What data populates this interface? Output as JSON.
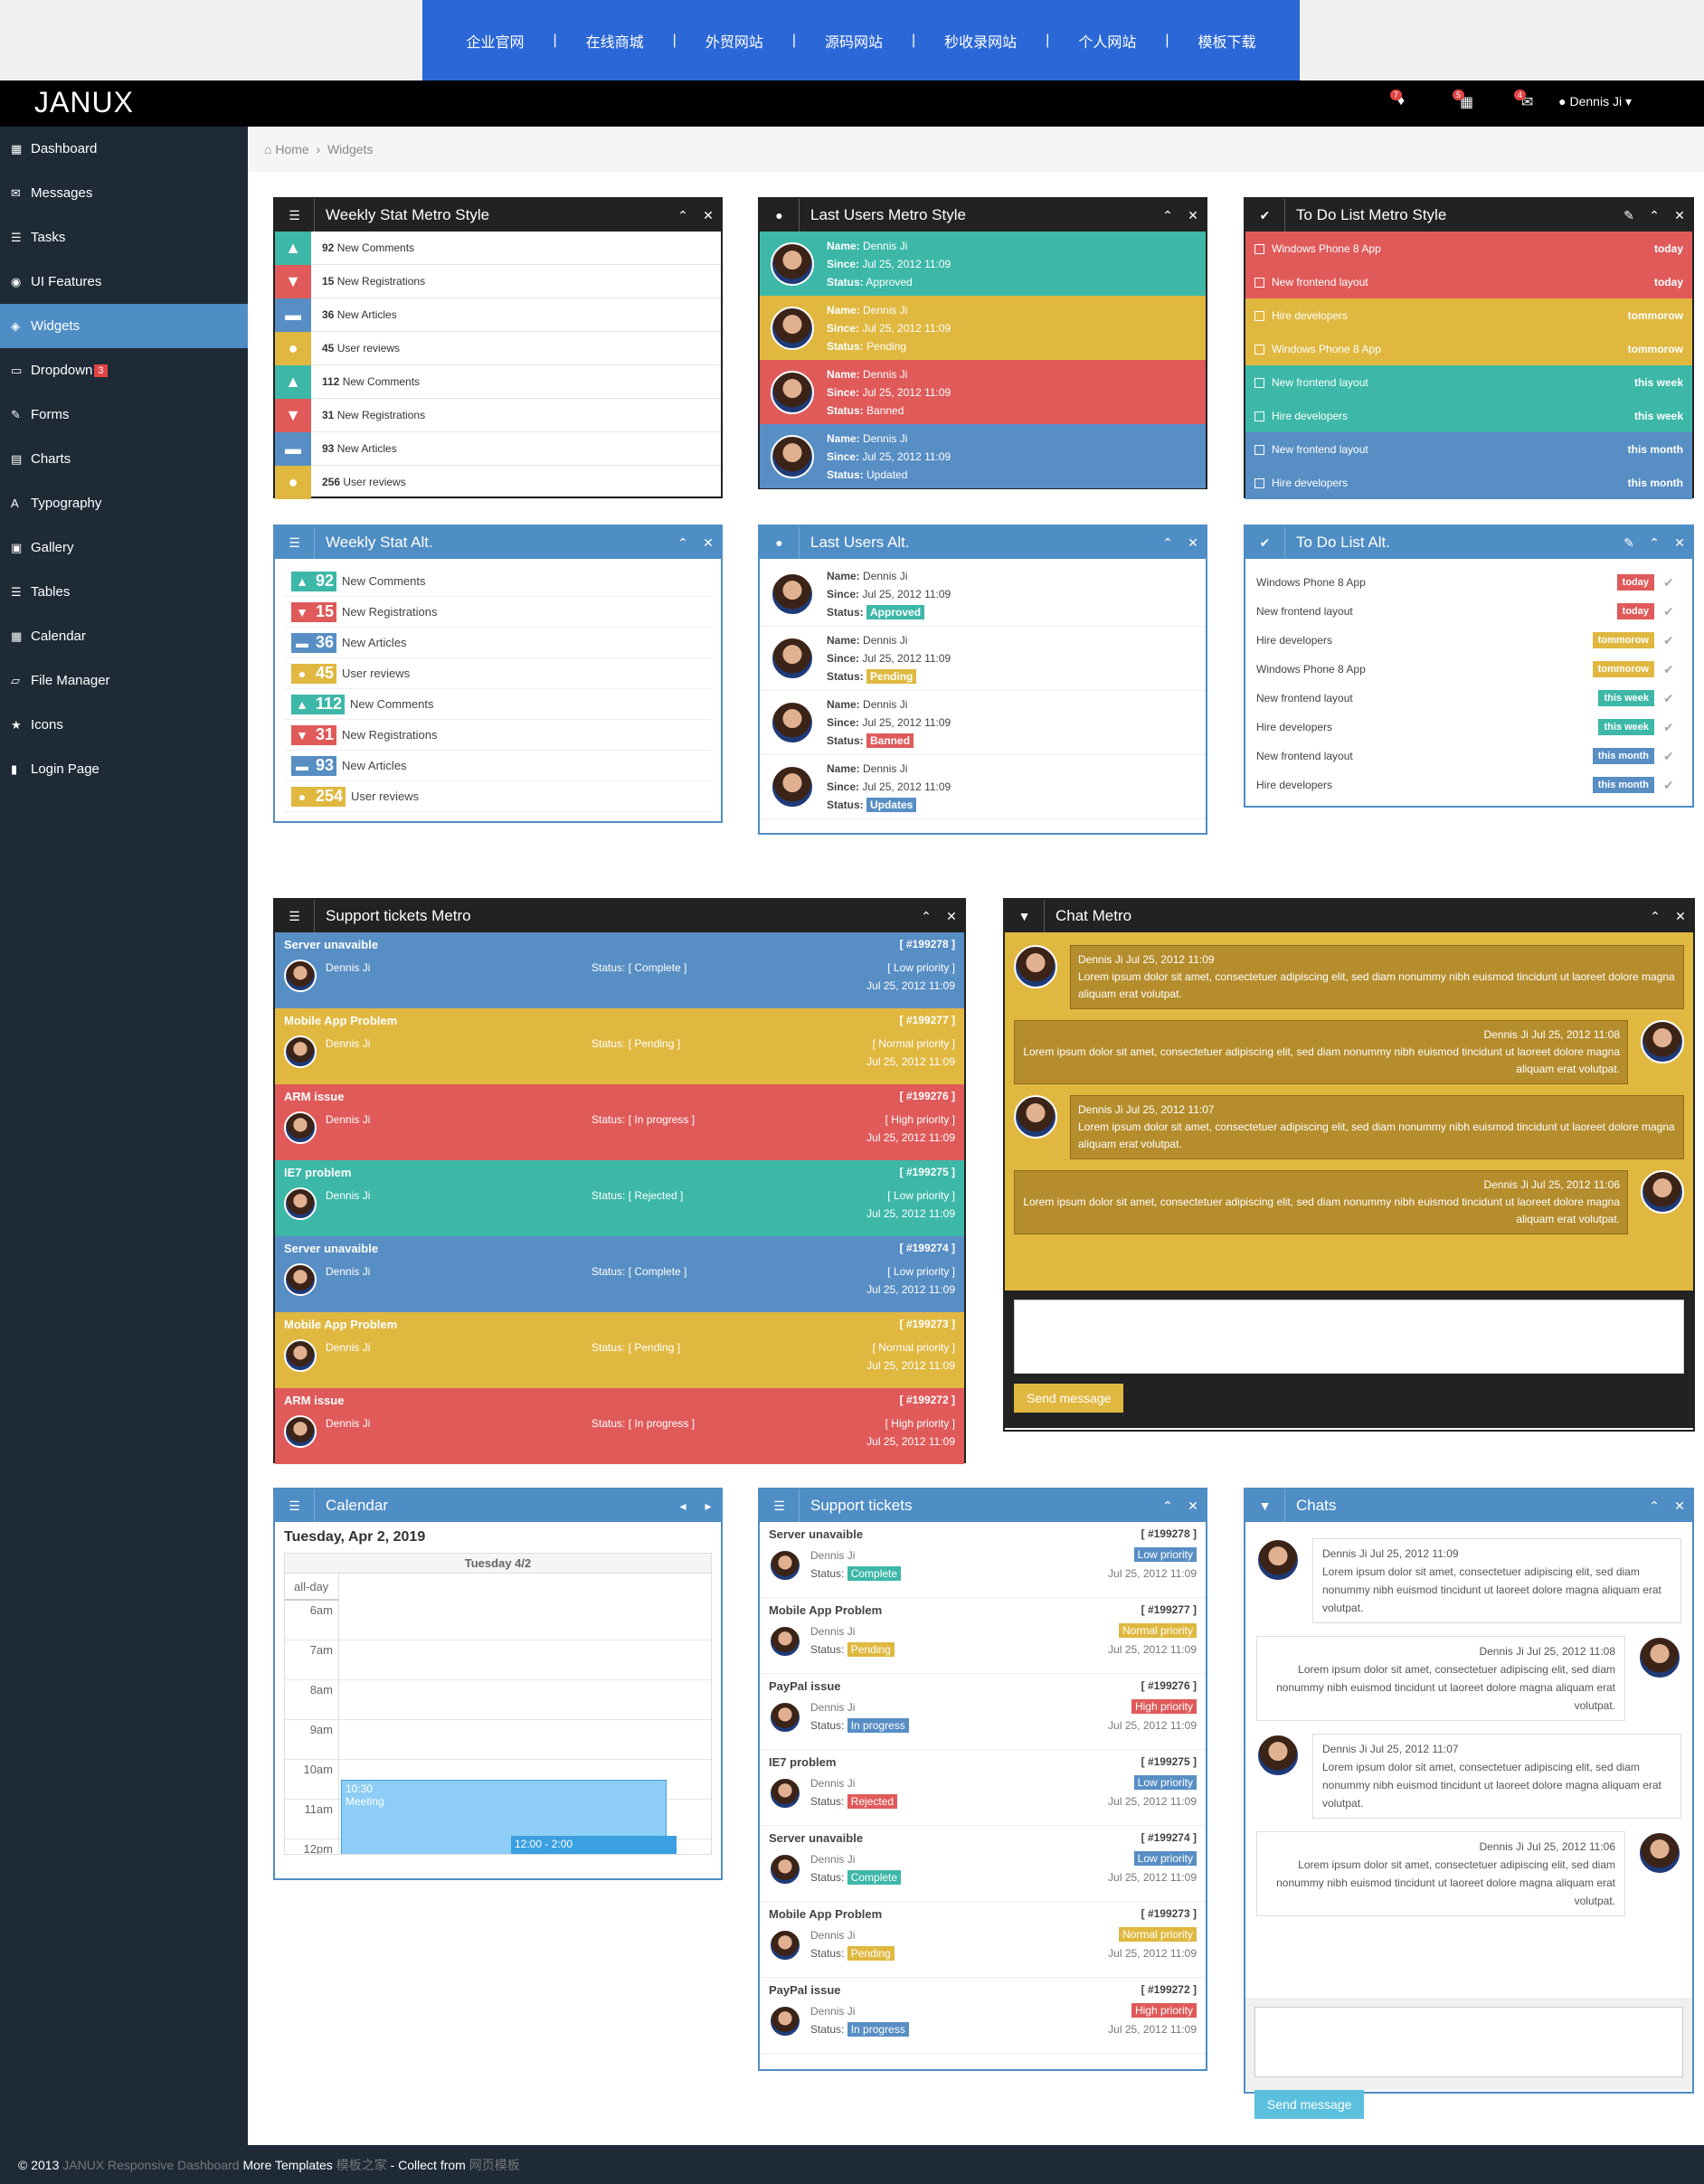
{
  "topnav": {
    "items": [
      "企业官网",
      "在线商城",
      "外贸网站",
      "源码网站",
      "秒收录网站",
      "个人网站",
      "模板下载"
    ]
  },
  "header": {
    "brand": "JANUX",
    "user": "Dennis Ji",
    "badges": [
      "7",
      "5",
      "4"
    ]
  },
  "sidebar": {
    "items": [
      {
        "label": "Dashboard",
        "icon": "dashboard-icon"
      },
      {
        "label": "Messages",
        "icon": "envelope-icon"
      },
      {
        "label": "Tasks",
        "icon": "list-icon"
      },
      {
        "label": "UI Features",
        "icon": "eye-icon"
      },
      {
        "label": "Widgets",
        "icon": "widgets-icon",
        "active": true
      },
      {
        "label": "Dropdown",
        "icon": "folder-icon",
        "badge": "3"
      },
      {
        "label": "Forms",
        "icon": "edit-icon"
      },
      {
        "label": "Charts",
        "icon": "chart-icon"
      },
      {
        "label": "Typography",
        "icon": "font-icon"
      },
      {
        "label": "Gallery",
        "icon": "picture-icon"
      },
      {
        "label": "Tables",
        "icon": "table-icon"
      },
      {
        "label": "Calendar",
        "icon": "calendar-icon"
      },
      {
        "label": "File Manager",
        "icon": "folder-open-icon"
      },
      {
        "label": "Icons",
        "icon": "star-icon"
      },
      {
        "label": "Login Page",
        "icon": "lock-icon"
      }
    ]
  },
  "breadcrumb": {
    "home": "Home",
    "current": "Widgets"
  },
  "colors": {
    "green": "#3db8a8",
    "red": "#e05a5a",
    "blue": "#578ec4",
    "yellow": "#e0b840",
    "dark": "#222222"
  },
  "weekly_metro": {
    "title": "Weekly Stat Metro Style",
    "rows": [
      {
        "n": "92",
        "label": "New Comments",
        "color": "green",
        "icon": "arrow-up-icon"
      },
      {
        "n": "15",
        "label": "New Registrations",
        "color": "red",
        "icon": "arrow-down-icon"
      },
      {
        "n": "36",
        "label": "New Articles",
        "color": "blue",
        "icon": "minus-icon"
      },
      {
        "n": "45",
        "label": "User reviews",
        "color": "yellow",
        "icon": "comment-icon"
      },
      {
        "n": "112",
        "label": "New Comments",
        "color": "green",
        "icon": "arrow-up-icon"
      },
      {
        "n": "31",
        "label": "New Registrations",
        "color": "red",
        "icon": "arrow-down-icon"
      },
      {
        "n": "93",
        "label": "New Articles",
        "color": "blue",
        "icon": "minus-icon"
      },
      {
        "n": "256",
        "label": "User reviews",
        "color": "yellow",
        "icon": "comment-icon"
      }
    ]
  },
  "users_metro": {
    "title": "Last Users Metro Style",
    "rows": [
      {
        "name": "Dennis Ji",
        "since": "Jul 25, 2012 11:09",
        "status": "Approved",
        "color": "green"
      },
      {
        "name": "Dennis Ji",
        "since": "Jul 25, 2012 11:09",
        "status": "Pending",
        "color": "yellow"
      },
      {
        "name": "Dennis Ji",
        "since": "Jul 25, 2012 11:09",
        "status": "Banned",
        "color": "red"
      },
      {
        "name": "Dennis Ji",
        "since": "Jul 25, 2012 11:09",
        "status": "Updated",
        "color": "blue"
      }
    ]
  },
  "todo_metro": {
    "title": "To Do List Metro Style",
    "rows": [
      {
        "task": "Windows Phone 8 App",
        "when": "today",
        "color": "red"
      },
      {
        "task": "New frontend layout",
        "when": "today",
        "color": "red"
      },
      {
        "task": "Hire developers",
        "when": "tommorow",
        "color": "yellow"
      },
      {
        "task": "Windows Phone 8 App",
        "when": "tommorow",
        "color": "yellow"
      },
      {
        "task": "New frontend layout",
        "when": "this week",
        "color": "green"
      },
      {
        "task": "Hire developers",
        "when": "this week",
        "color": "green"
      },
      {
        "task": "New frontend layout",
        "when": "this month",
        "color": "blue"
      },
      {
        "task": "Hire developers",
        "when": "this month",
        "color": "blue"
      }
    ]
  },
  "weekly_alt": {
    "title": "Weekly Stat Alt.",
    "rows": [
      {
        "n": "92",
        "label": "New Comments",
        "color": "green",
        "icon": "arrow-up-icon"
      },
      {
        "n": "15",
        "label": "New Registrations",
        "color": "red",
        "icon": "arrow-down-icon"
      },
      {
        "n": "36",
        "label": "New Articles",
        "color": "blue",
        "icon": "minus-icon"
      },
      {
        "n": "45",
        "label": "User reviews",
        "color": "yellow",
        "icon": "comment-icon"
      },
      {
        "n": "112",
        "label": "New Comments",
        "color": "green",
        "icon": "arrow-up-icon"
      },
      {
        "n": "31",
        "label": "New Registrations",
        "color": "red",
        "icon": "arrow-down-icon"
      },
      {
        "n": "93",
        "label": "New Articles",
        "color": "blue",
        "icon": "minus-icon"
      },
      {
        "n": "254",
        "label": "User reviews",
        "color": "yellow",
        "icon": "comment-icon"
      }
    ]
  },
  "users_alt": {
    "title": "Last Users Alt.",
    "rows": [
      {
        "name": "Dennis Ji",
        "since": "Jul 25, 2012 11:09",
        "status": "Approved",
        "color": "green"
      },
      {
        "name": "Dennis Ji",
        "since": "Jul 25, 2012 11:09",
        "status": "Pending",
        "color": "yellow"
      },
      {
        "name": "Dennis Ji",
        "since": "Jul 25, 2012 11:09",
        "status": "Banned",
        "color": "red"
      },
      {
        "name": "Dennis Ji",
        "since": "Jul 25, 2012 11:09",
        "status": "Updates",
        "color": "blue"
      }
    ]
  },
  "todo_alt": {
    "title": "To Do List Alt.",
    "rows": [
      {
        "task": "Windows Phone 8 App",
        "when": "today",
        "color": "red"
      },
      {
        "task": "New frontend layout",
        "when": "today",
        "color": "red"
      },
      {
        "task": "Hire developers",
        "when": "tommorow",
        "color": "yellow"
      },
      {
        "task": "Windows Phone 8 App",
        "when": "tommorow",
        "color": "yellow"
      },
      {
        "task": "New frontend layout",
        "when": "this week",
        "color": "green"
      },
      {
        "task": "Hire developers",
        "when": "this week",
        "color": "green"
      },
      {
        "task": "New frontend layout",
        "when": "this month",
        "color": "blue"
      },
      {
        "task": "Hire developers",
        "when": "this month",
        "color": "blue"
      }
    ]
  },
  "labels": {
    "name": "Name:",
    "since": "Since:",
    "status": "Status:"
  },
  "tickets_metro": {
    "title": "Support tickets Metro",
    "rows": [
      {
        "title": "Server unavaible",
        "id": "[ #199278 ]",
        "name": "Dennis Ji",
        "status": "Status: [ Complete ]",
        "priority": "[ Low priority ]",
        "date": "Jul 25, 2012 11:09",
        "color": "blue"
      },
      {
        "title": "Mobile App Problem",
        "id": "[ #199277 ]",
        "name": "Dennis Ji",
        "status": "Status: [ Pending ]",
        "priority": "[ Normal priority ]",
        "date": "Jul 25, 2012 11:09",
        "color": "yellow"
      },
      {
        "title": "ARM issue",
        "id": "[ #199276 ]",
        "name": "Dennis Ji",
        "status": "Status: [ In progress ]",
        "priority": "[ High priority ]",
        "date": "Jul 25, 2012 11:09",
        "color": "red"
      },
      {
        "title": "IE7 problem",
        "id": "[ #199275 ]",
        "name": "Dennis Ji",
        "status": "Status: [ Rejected ]",
        "priority": "[ Low priority ]",
        "date": "Jul 25, 2012 11:09",
        "color": "green"
      },
      {
        "title": "Server unavaible",
        "id": "[ #199274 ]",
        "name": "Dennis Ji",
        "status": "Status: [ Complete ]",
        "priority": "[ Low priority ]",
        "date": "Jul 25, 2012 11:09",
        "color": "blue"
      },
      {
        "title": "Mobile App Problem",
        "id": "[ #199273 ]",
        "name": "Dennis Ji",
        "status": "Status: [ Pending ]",
        "priority": "[ Normal priority ]",
        "date": "Jul 25, 2012 11:09",
        "color": "yellow"
      },
      {
        "title": "ARM issue",
        "id": "[ #199272 ]",
        "name": "Dennis Ji",
        "status": "Status: [ In progress ]",
        "priority": "[ High priority ]",
        "date": "Jul 25, 2012 11:09",
        "color": "red"
      }
    ]
  },
  "chat_metro": {
    "title": "Chat Metro",
    "send": "Send message",
    "messages": [
      {
        "meta": "Dennis Ji Jul 25, 2012 11:09",
        "text": "Lorem ipsum dolor sit amet, consectetuer adipiscing elit, sed diam nonummy nibh euismod tincidunt ut laoreet dolore magna aliquam erat volutpat.",
        "side": "left"
      },
      {
        "meta": "Dennis Ji Jul 25, 2012 11:08",
        "text": "Lorem ipsum dolor sit amet, consectetuer adipiscing elit, sed diam nonummy nibh euismod tincidunt ut laoreet dolore magna aliquam erat volutpat.",
        "side": "right"
      },
      {
        "meta": "Dennis Ji Jul 25, 2012 11:07",
        "text": "Lorem ipsum dolor sit amet, consectetuer adipiscing elit, sed diam nonummy nibh euismod tincidunt ut laoreet dolore magna aliquam erat volutpat.",
        "side": "left"
      },
      {
        "meta": "Dennis Ji Jul 25, 2012 11:06",
        "text": "Lorem ipsum dolor sit amet, consectetuer adipiscing elit, sed diam nonummy nibh euismod tincidunt ut laoreet dolore magna aliquam erat volutpat.",
        "side": "right"
      }
    ]
  },
  "calendar": {
    "title": "Calendar",
    "date": "Tuesday, Apr 2, 2019",
    "col": "Tuesday 4/2",
    "allday": "all-day",
    "hours": [
      "6am",
      "7am",
      "8am",
      "9am",
      "10am",
      "11am",
      "12pm"
    ],
    "event_time": "10:30",
    "event_title": "Meeting",
    "event2_time": "12:00 - 2:00"
  },
  "tickets": {
    "title": "Support tickets",
    "rows": [
      {
        "title": "Server unavaible",
        "id": "[ #199278 ]",
        "name": "Dennis Ji",
        "status": "Complete",
        "status_color": "green",
        "priority": "Low priority",
        "priority_color": "blue",
        "date": "Jul 25, 2012 11:09"
      },
      {
        "title": "Mobile App Problem",
        "id": "[ #199277 ]",
        "name": "Dennis Ji",
        "status": "Pending",
        "status_color": "yellow",
        "priority": "Normal priority",
        "priority_color": "yellow",
        "date": "Jul 25, 2012 11:09"
      },
      {
        "title": "PayPal issue",
        "id": "[ #199276 ]",
        "name": "Dennis Ji",
        "status": "In progress",
        "status_color": "blue",
        "priority": "High priority",
        "priority_color": "red",
        "date": "Jul 25, 2012 11:09"
      },
      {
        "title": "IE7 problem",
        "id": "[ #199275 ]",
        "name": "Dennis Ji",
        "status": "Rejected",
        "status_color": "red",
        "priority": "Low priority",
        "priority_color": "blue",
        "date": "Jul 25, 2012 11:09"
      },
      {
        "title": "Server unavaible",
        "id": "[ #199274 ]",
        "name": "Dennis Ji",
        "status": "Complete",
        "status_color": "green",
        "priority": "Low priority",
        "priority_color": "blue",
        "date": "Jul 25, 2012 11:09"
      },
      {
        "title": "Mobile App Problem",
        "id": "[ #199273 ]",
        "name": "Dennis Ji",
        "status": "Pending",
        "status_color": "yellow",
        "priority": "Normal priority",
        "priority_color": "yellow",
        "date": "Jul 25, 2012 11:09"
      },
      {
        "title": "PayPal issue",
        "id": "[ #199272 ]",
        "name": "Dennis Ji",
        "status": "In progress",
        "status_color": "blue",
        "priority": "High priority",
        "priority_color": "red",
        "date": "Jul 25, 2012 11:09"
      }
    ]
  },
  "chats": {
    "title": "Chats",
    "send": "Send message",
    "messages": [
      {
        "meta": "Dennis Ji Jul 25, 2012 11:09",
        "text": "Lorem ipsum dolor sit amet, consectetuer adipiscing elit, sed diam nonummy nibh euismod tincidunt ut laoreet dolore magna aliquam erat volutpat.",
        "side": "left"
      },
      {
        "meta": "Dennis Ji Jul 25, 2012 11:08",
        "text": "Lorem ipsum dolor sit amet, consectetuer adipiscing elit, sed diam nonummy nibh euismod tincidunt ut laoreet dolore magna aliquam erat volutpat.",
        "side": "right"
      },
      {
        "meta": "Dennis Ji Jul 25, 2012 11:07",
        "text": "Lorem ipsum dolor sit amet, consectetuer adipiscing elit, sed diam nonummy nibh euismod tincidunt ut laoreet dolore magna aliquam erat volutpat.",
        "side": "left"
      },
      {
        "meta": "Dennis Ji Jul 25, 2012 11:06",
        "text": "Lorem ipsum dolor sit amet, consectetuer adipiscing elit, sed diam nonummy nibh euismod tincidunt ut laoreet dolore magna aliquam erat volutpat.",
        "side": "right"
      }
    ]
  },
  "footer": {
    "copy": "© 2013",
    "product": "JANUX Responsive Dashboard",
    "more": "More Templates",
    "cn1": "模板之家",
    "collect": "- Collect from",
    "cn2": "网页模板"
  }
}
